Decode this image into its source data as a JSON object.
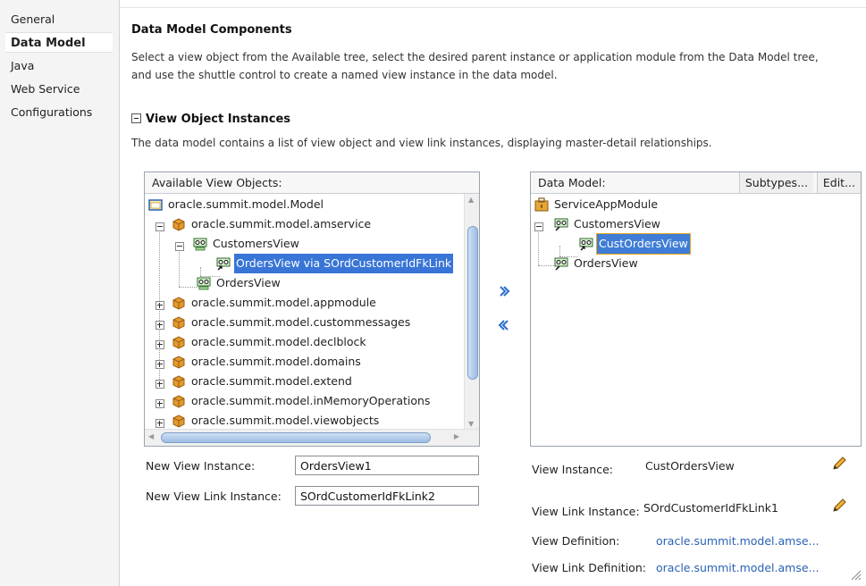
{
  "nav": {
    "items": [
      {
        "label": "General",
        "selected": false
      },
      {
        "label": "Data Model",
        "selected": true
      },
      {
        "label": "Java",
        "selected": false
      },
      {
        "label": "Web Service",
        "selected": false
      },
      {
        "label": "Configurations",
        "selected": false
      }
    ]
  },
  "header": {
    "title": "Data Model Components",
    "description_line1": "Select a view object from the Available tree, select the desired parent instance or application module from the Data Model tree,",
    "description_line2": "and use the shuttle control to create a named view instance in the data model."
  },
  "section": {
    "title": "View Object Instances",
    "description": "The data model contains a list of view object and view link instances, displaying master-detail relationships."
  },
  "available": {
    "header": "Available View Objects:",
    "tree": [
      {
        "label": "oracle.summit.model.Model",
        "icon": "folder-icon"
      },
      {
        "label": "oracle.summit.model.amservice",
        "icon": "package-icon",
        "expanded": true
      },
      {
        "label": "CustomersView",
        "icon": "view-object-icon",
        "expanded": true
      },
      {
        "label": "OrdersView via SOrdCustomerIdFkLink",
        "icon": "view-link-icon",
        "selected": true
      },
      {
        "label": "OrdersView",
        "icon": "view-object-icon"
      },
      {
        "label": "oracle.summit.model.appmodule",
        "icon": "package-icon"
      },
      {
        "label": "oracle.summit.model.custommessages",
        "icon": "package-icon"
      },
      {
        "label": "oracle.summit.model.declblock",
        "icon": "package-icon"
      },
      {
        "label": "oracle.summit.model.domains",
        "icon": "package-icon"
      },
      {
        "label": "oracle.summit.model.extend",
        "icon": "package-icon"
      },
      {
        "label": "oracle.summit.model.inMemoryOperations",
        "icon": "package-icon"
      },
      {
        "label": "oracle.summit.model.viewobjects",
        "icon": "package-icon"
      }
    ]
  },
  "datamodel": {
    "header": "Data Model:",
    "subtypes_label": "Subtypes...",
    "edit_label": "Edit...",
    "tree": [
      {
        "label": "ServiceAppModule",
        "icon": "app-module-icon"
      },
      {
        "label": "CustomersView",
        "icon": "view-object-icon"
      },
      {
        "label": "CustOrdersView",
        "icon": "view-link-icon",
        "selected": true
      },
      {
        "label": "OrdersView",
        "icon": "view-object-icon"
      }
    ]
  },
  "form": {
    "new_view_instance_label": "New View Instance:",
    "new_view_instance_value": "OrdersView1",
    "new_view_link_instance_label": "New View Link Instance:",
    "new_view_link_instance_value": "SOrdCustomerIdFkLink2"
  },
  "details": {
    "view_instance_label": "View Instance:",
    "view_instance_value": "CustOrdersView",
    "view_link_instance_label": "View Link Instance:",
    "view_link_instance_value": "SOrdCustomerIdFkLink1",
    "view_definition_label": "View Definition:",
    "view_definition_value": "oracle.summit.model.amse...",
    "view_link_definition_label": "View Link Definition:",
    "view_link_definition_value": "oracle.summit.model.amse..."
  },
  "colors": {
    "selection": "#3875d7",
    "link": "#2a62b5",
    "accent": "#2b6fc9"
  }
}
